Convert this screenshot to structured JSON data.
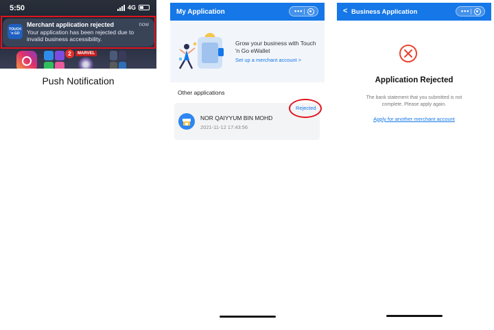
{
  "notification_panel": {
    "status_time": "5:50",
    "network": "4G",
    "app_badge_count": "2",
    "marvel_label": "MARVEL",
    "notification": {
      "app_icon_text": "TOUCH 'n GO",
      "title": "Merchant application rejected",
      "time": "now",
      "body": "Your application has been rejected due to invalid business accessibility."
    },
    "caption": "Push Notification"
  },
  "my_application": {
    "header_title": "My Application",
    "menu_dots": "•••",
    "promo_text": "Grow your business with Touch 'n Go eWallet",
    "promo_link": "Set up a merchant account >",
    "section_title": "Other applications",
    "applications": [
      {
        "name": "NOR QAIYYUM BIN MOHD",
        "date": "2021-11-12 17:43:56",
        "status": "Rejected"
      }
    ]
  },
  "business_application": {
    "back_glyph": "<",
    "header_title": "Business Application",
    "menu_dots": "•••",
    "status_title": "Application Rejected",
    "message": "The bank statement that you submitted is not complete. Please apply again.",
    "link": "Apply for another merchant account"
  },
  "colors": {
    "brand_blue": "#1577e8",
    "highlight_red": "#e0141e",
    "reject_red": "#e8432e"
  }
}
